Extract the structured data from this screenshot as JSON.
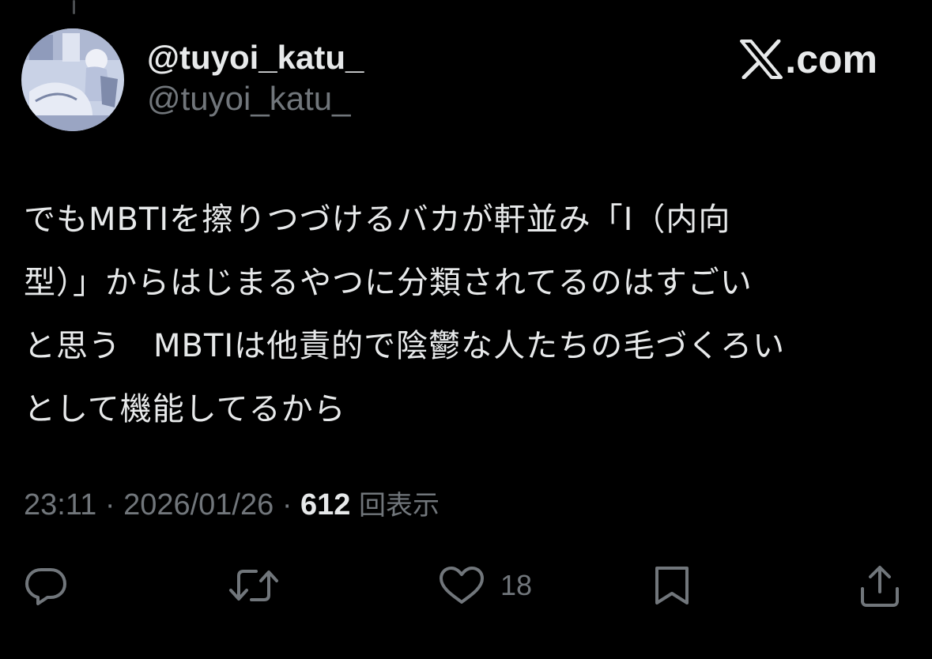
{
  "header": {
    "display_name": "@tuyoi_katu_",
    "handle": "@tuyoi_katu_",
    "brand_text": ".com",
    "brand_icon": "x-logo-icon"
  },
  "tweet": {
    "lines": [
      "でもMBTIを擦りつづけるバカが軒並み「I（内向",
      "型）」からはじまるやつに分類されてるのはすごい",
      "と思う　MBTIは他責的で陰鬱な人たちの毛づくろい",
      "として機能してるから"
    ]
  },
  "meta": {
    "time": "23:11",
    "separator": "·",
    "date": "2026/01/26",
    "views_count": "612",
    "views_label": "回表示"
  },
  "actions": {
    "reply_icon": "reply-icon",
    "retweet_icon": "retweet-icon",
    "like_icon": "heart-icon",
    "like_count": "18",
    "bookmark_icon": "bookmark-icon",
    "share_icon": "share-icon"
  },
  "colors": {
    "background": "#000000",
    "primary_text": "#e7e9ea",
    "secondary_text": "#71767b"
  }
}
